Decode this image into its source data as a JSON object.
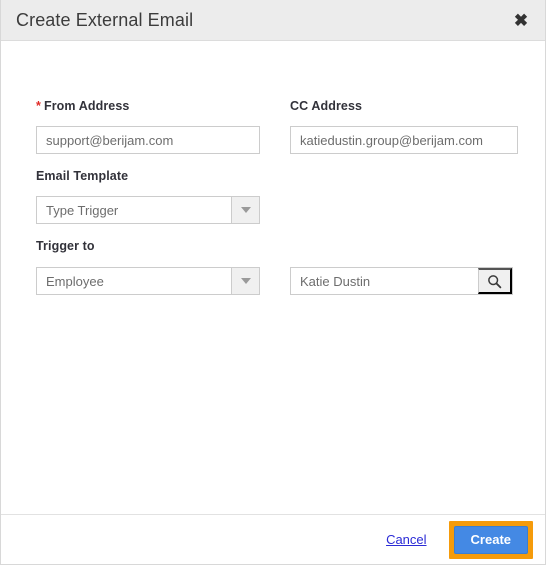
{
  "dialog": {
    "title": "Create External Email",
    "close_icon": "close-icon"
  },
  "form": {
    "from_address": {
      "label": "From Address",
      "required_marker": "*",
      "value": "support@berijam.com",
      "placeholder": "support@berijam.com"
    },
    "cc_address": {
      "label": "CC Address",
      "value": "katiedustin.group@berijam.com",
      "placeholder": "katiedustin.group@berijam.com"
    },
    "email_template": {
      "label": "Email Template",
      "value": "Type Trigger",
      "arrow_icon": "chevron-down-icon"
    },
    "trigger_to": {
      "label": "Trigger to",
      "value": "Employee",
      "arrow_icon": "chevron-down-icon"
    },
    "recipient_search": {
      "value": "Katie Dustin",
      "placeholder": "Katie Dustin",
      "button_icon": "search-icon"
    }
  },
  "footer": {
    "cancel_label": "Cancel",
    "create_label": "Create"
  },
  "colors": {
    "header_bg": "#ececec",
    "accent_blue": "#4489e4",
    "highlight_orange": "#f59b0b",
    "required_red": "#e02b27",
    "link_blue": "#2b2bd6"
  }
}
